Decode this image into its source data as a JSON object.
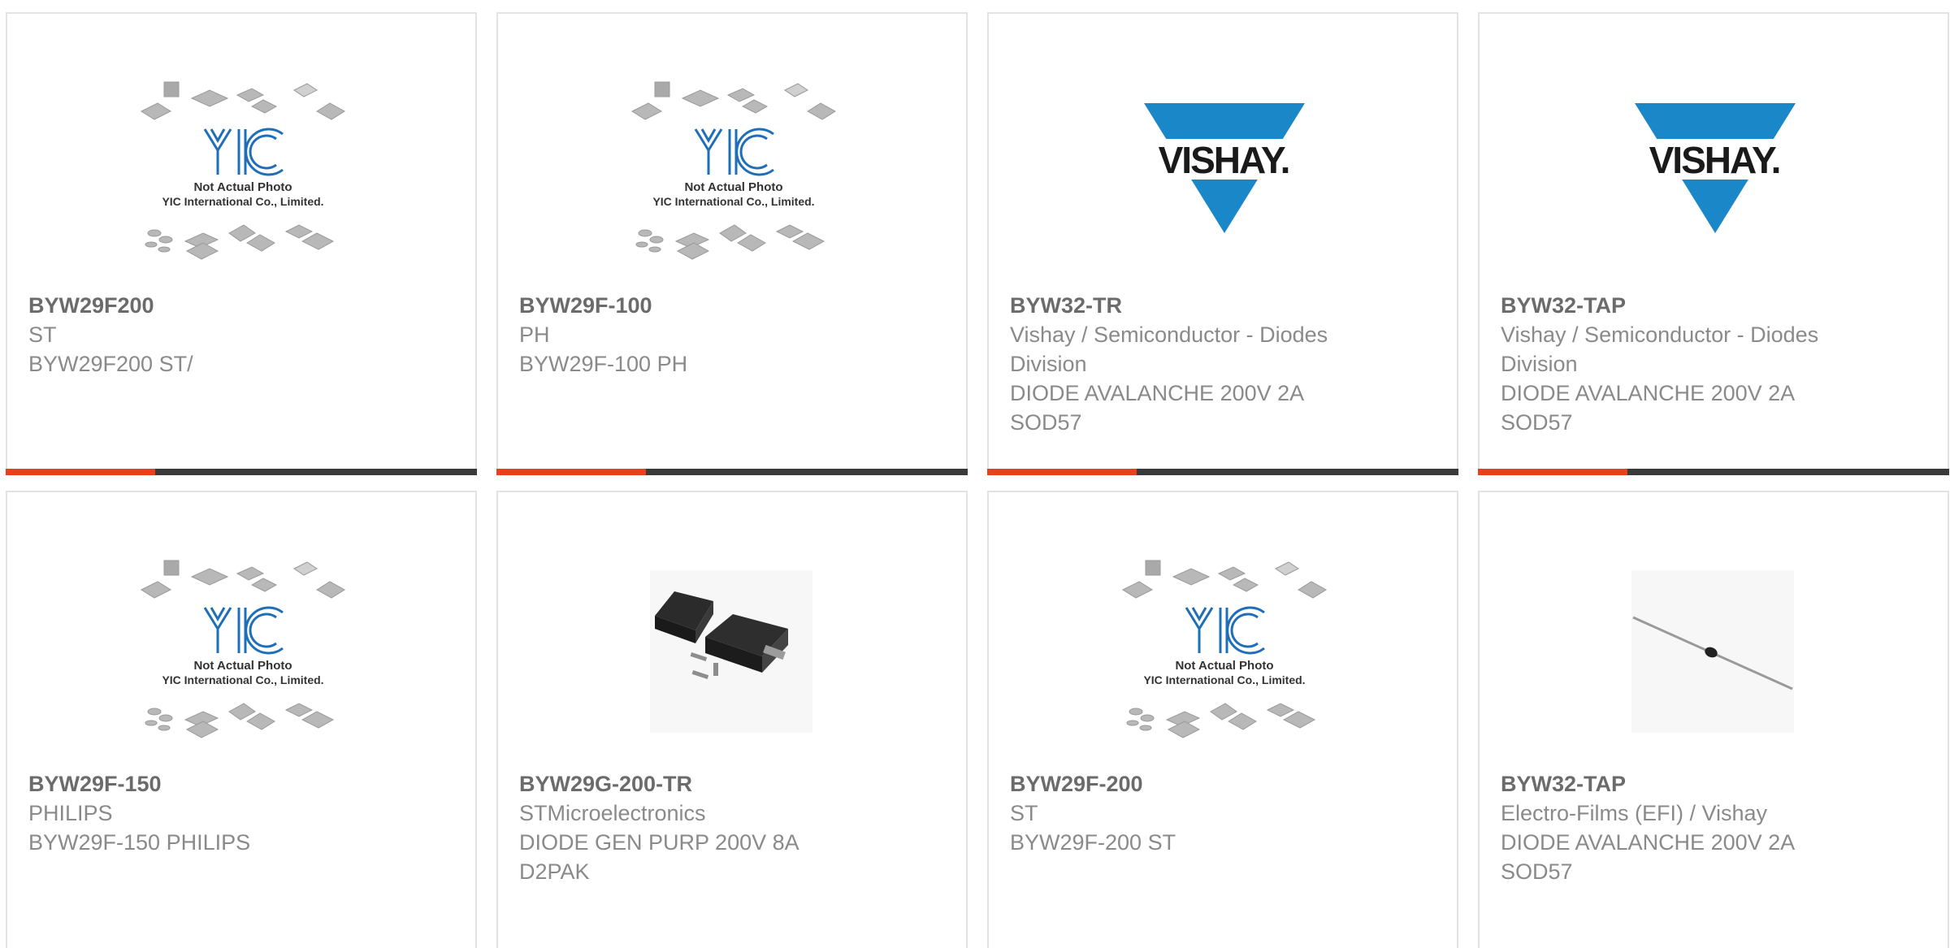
{
  "products": [
    {
      "part_number": "BYW29F200",
      "lines": [
        "ST",
        "BYW29F200 ST/"
      ],
      "image": "yic-placeholder",
      "image_caption": [
        "Not Actual Photo",
        "YIC International Co., Limited."
      ],
      "logo_text": "YIC"
    },
    {
      "part_number": "BYW29F-100",
      "lines": [
        "PH",
        "BYW29F-100 PH"
      ],
      "image": "yic-placeholder",
      "image_caption": [
        "Not Actual Photo",
        "YIC International Co., Limited."
      ],
      "logo_text": "YIC"
    },
    {
      "part_number": "BYW32-TR",
      "lines": [
        "Vishay / Semiconductor - Diodes",
        "Division",
        "DIODE AVALANCHE 200V 2A",
        "SOD57"
      ],
      "image": "vishay-logo",
      "logo_text": "VISHAY."
    },
    {
      "part_number": "BYW32-TAP",
      "lines": [
        "Vishay / Semiconductor - Diodes",
        "Division",
        "DIODE AVALANCHE 200V 2A",
        "SOD57"
      ],
      "image": "vishay-logo",
      "logo_text": "VISHAY."
    },
    {
      "part_number": "BYW29F-150",
      "lines": [
        "PHILIPS",
        "BYW29F-150 PHILIPS"
      ],
      "image": "yic-placeholder",
      "image_caption": [
        "Not Actual Photo",
        "YIC International Co., Limited."
      ],
      "logo_text": "YIC"
    },
    {
      "part_number": "BYW29G-200-TR",
      "lines": [
        "STMicroelectronics",
        "DIODE GEN PURP 200V 8A",
        "D2PAK"
      ],
      "image": "d2pak-photo"
    },
    {
      "part_number": "BYW29F-200",
      "lines": [
        "ST",
        "BYW29F-200 ST"
      ],
      "image": "yic-placeholder",
      "image_caption": [
        "Not Actual Photo",
        "YIC International Co., Limited."
      ],
      "logo_text": "YIC"
    },
    {
      "part_number": "BYW32-TAP",
      "lines": [
        "Electro-Films (EFI) / Vishay",
        "DIODE AVALANCHE 200V 2A",
        "SOD57"
      ],
      "image": "axial-diode-photo"
    }
  ],
  "colors": {
    "accent": "#e8401c",
    "bar": "#3a3a3a",
    "vishay_blue": "#1a87c9",
    "yic_blue": "#1e6fb8"
  }
}
